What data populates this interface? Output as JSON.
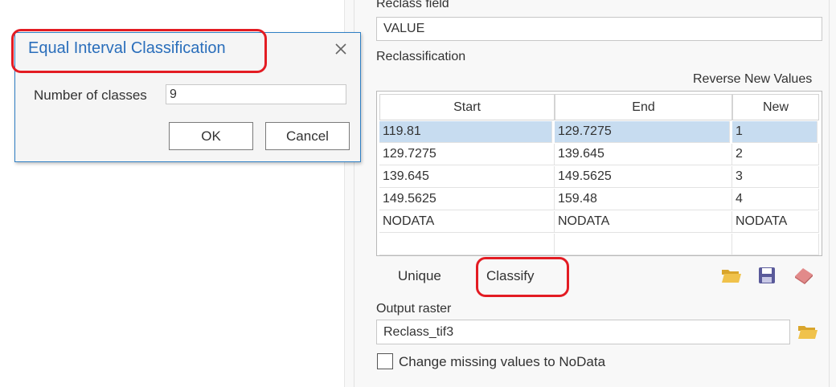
{
  "pane": {
    "reclass_field_label": "Reclass field",
    "reclass_field_value": "VALUE",
    "reclassification_label": "Reclassification",
    "reverse_new_values": "Reverse New Values",
    "table": {
      "headers": [
        "Start",
        "End",
        "New"
      ],
      "rows": [
        [
          "119.81",
          "129.7275",
          "1"
        ],
        [
          "129.7275",
          "139.645",
          "2"
        ],
        [
          "139.645",
          "149.5625",
          "3"
        ],
        [
          "149.5625",
          "159.48",
          "4"
        ],
        [
          "NODATA",
          "NODATA",
          "NODATA"
        ],
        [
          "",
          "",
          ""
        ]
      ]
    },
    "unique_label": "Unique",
    "classify_label": "Classify",
    "output_raster_label": "Output raster",
    "output_raster_value": "Reclass_tif3",
    "missing_values_label": "Change missing values to NoData",
    "missing_values_checked": false
  },
  "dialog": {
    "title": "Equal Interval Classification",
    "num_classes_label": "Number of classes",
    "num_classes_value": "9",
    "ok_label": "OK",
    "cancel_label": "Cancel"
  },
  "colors": {
    "selection": "#c7dcf0",
    "title_blue": "#2a6ebb",
    "annotation_red": "#e31c23",
    "folder_yellow": "#e8b83a",
    "save_purple": "#5a5a9a",
    "eraser_pink": "#e28a8a"
  },
  "icons": [
    "folder-open-icon",
    "save-icon",
    "eraser-icon",
    "folder-open-icon",
    "close-icon"
  ]
}
